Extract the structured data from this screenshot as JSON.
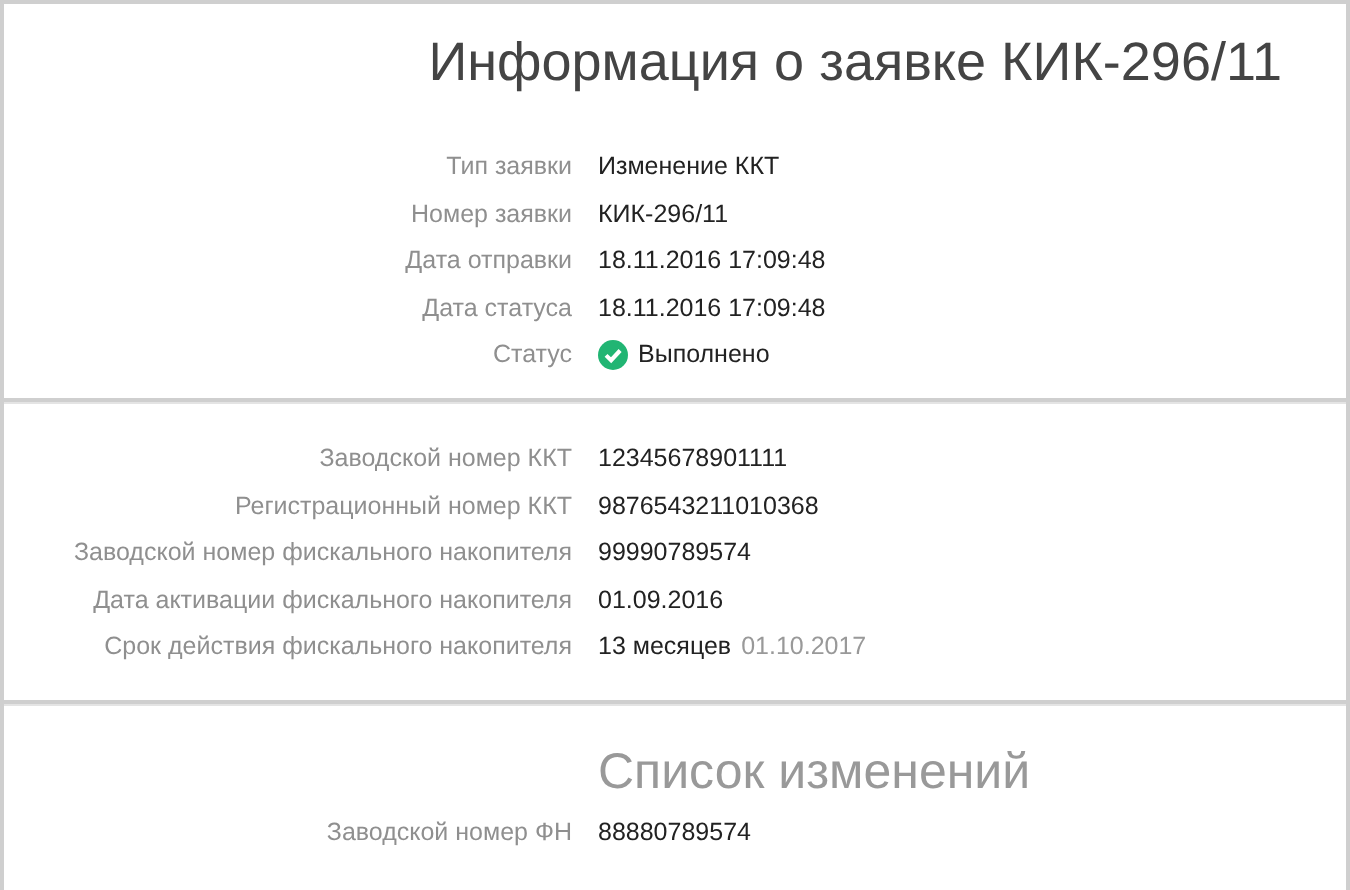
{
  "title": "Информация о заявке КИК-296/11",
  "request": [
    {
      "label": "Тип заявки",
      "value": "Изменение ККТ",
      "kind": "text"
    },
    {
      "label": "Номер заявки",
      "value": "КИК-296/11",
      "kind": "text"
    },
    {
      "label": "Дата отправки",
      "value": "18.11.2016 17:09:48",
      "kind": "text"
    },
    {
      "label": "Дата статуса",
      "value": "18.11.2016 17:09:48",
      "kind": "text"
    },
    {
      "label": "Статус",
      "value": "Выполнено",
      "kind": "status"
    }
  ],
  "device": [
    {
      "label": "Заводской номер ККТ",
      "value": "12345678901111",
      "kind": "text"
    },
    {
      "label": "Регистрационный номер ККТ",
      "value": "9876543211010368",
      "kind": "text"
    },
    {
      "label": "Заводской номер фискального накопителя",
      "value": "99990789574",
      "kind": "text"
    },
    {
      "label": "Дата активации фискального накопителя",
      "value": "01.09.2016",
      "kind": "text"
    },
    {
      "label": "Срок действия фискального накопителя",
      "value": "13 месяцев",
      "note": "01.10.2017",
      "kind": "text"
    }
  ],
  "changes": {
    "title": "Список изменений",
    "rows": [
      {
        "label": "Заводской номер ФН",
        "value": "88880789574",
        "kind": "text"
      }
    ]
  }
}
